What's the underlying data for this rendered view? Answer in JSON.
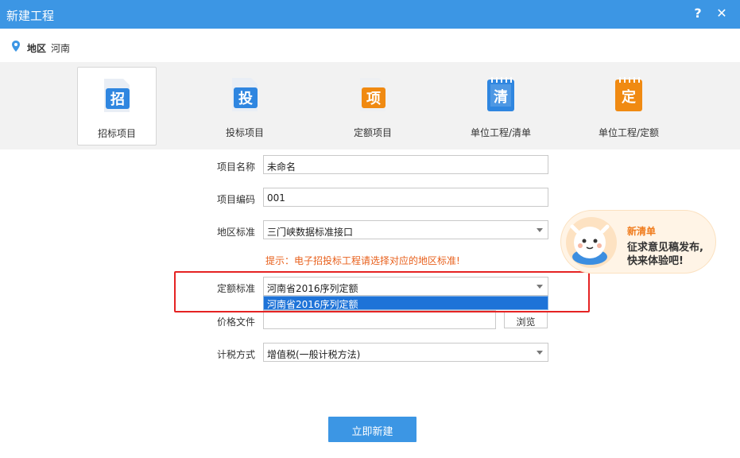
{
  "window": {
    "title": "新建工程",
    "help_glyph": "?",
    "close_glyph": "✕"
  },
  "region": {
    "label": "地区",
    "value": "河南"
  },
  "project_types": [
    {
      "label": "招标项目",
      "glyph": "招",
      "selected": true,
      "color": "#2f86e0"
    },
    {
      "label": "投标项目",
      "glyph": "投",
      "selected": false,
      "color": "#2f86e0"
    },
    {
      "label": "定额项目",
      "glyph": "项",
      "selected": false,
      "color": "#f08a12"
    },
    {
      "label": "单位工程/清单",
      "glyph": "清",
      "selected": false,
      "color": "#2f86e0"
    },
    {
      "label": "单位工程/定额",
      "glyph": "定",
      "selected": false,
      "color": "#f08a12"
    }
  ],
  "form": {
    "name_label": "项目名称",
    "name_value": "未命名",
    "code_label": "项目编码",
    "code_value": "001",
    "region_std_label": "地区标准",
    "region_std_value": "三门峡数据标准接口",
    "hint": "提示：电子招投标工程请选择对应的地区标准!",
    "quota_label": "定额标准",
    "quota_value": "河南省2016序列定额",
    "quota_options": [
      "河南省2016序列定额"
    ],
    "price_label": "价格文件",
    "price_value": "",
    "browse_label": "浏览",
    "tax_label": "计税方式",
    "tax_value": "增值税(一般计税方法)"
  },
  "create_button": "立即新建",
  "promo": {
    "title": "新清单",
    "line1": "征求意见稿发布,",
    "line2": "快来体验吧!"
  },
  "colors": {
    "accent": "#3c96e4",
    "hint": "#e8601c",
    "highlight": "#e52323",
    "selected_option": "#1e73d8"
  }
}
